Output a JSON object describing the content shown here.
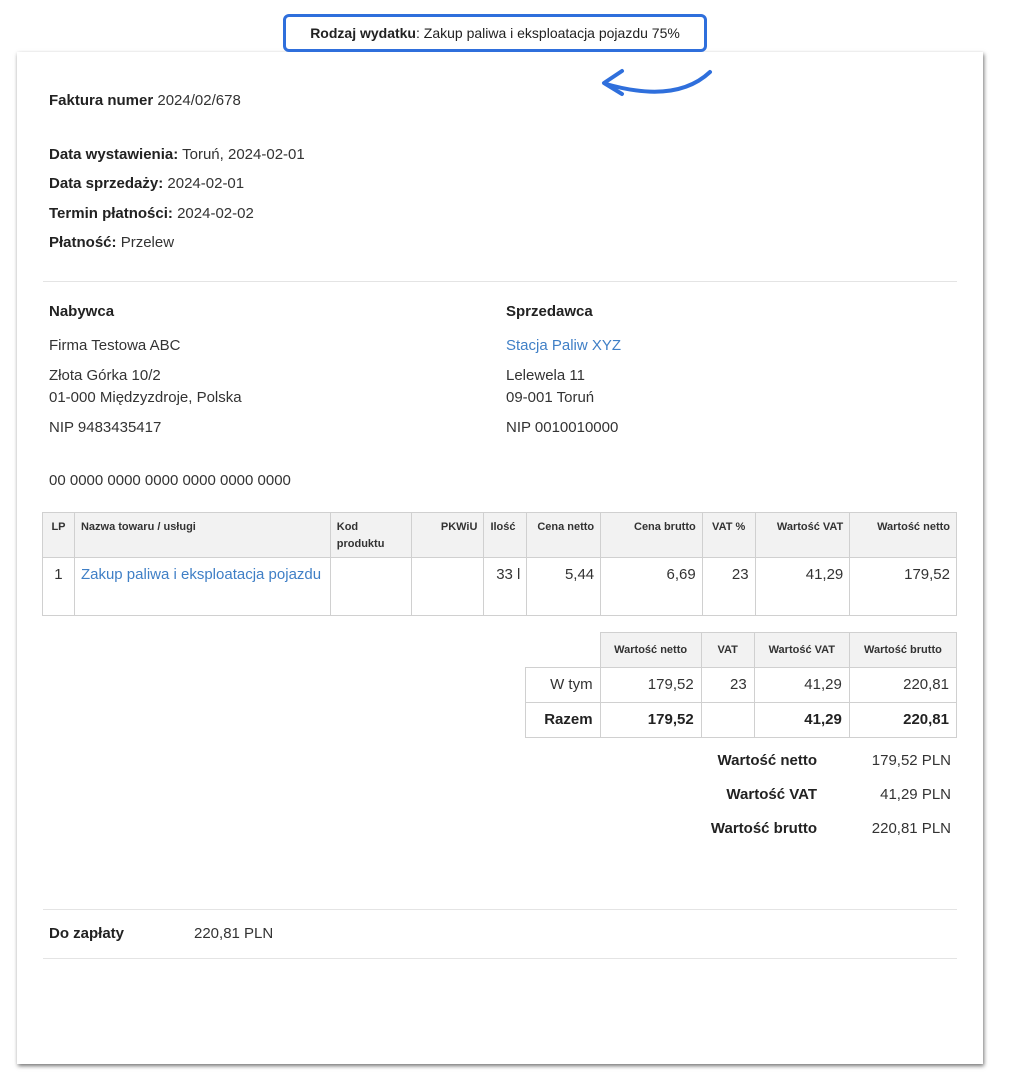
{
  "annotation": {
    "label": "Rodzaj wydatku",
    "value": "Zakup paliwa i eksploatacja pojazdu 75%"
  },
  "invoice": {
    "title_label": "Faktura numer",
    "number": "2024/02/678",
    "details": [
      {
        "label": "Data wystawienia:",
        "value": "Toruń, 2024-02-01"
      },
      {
        "label": "Data sprzedaży:",
        "value": "2024-02-01"
      },
      {
        "label": "Termin płatności:",
        "value": "2024-02-02"
      },
      {
        "label": "Płatność:",
        "value": "Przelew"
      }
    ]
  },
  "buyer": {
    "heading": "Nabywca",
    "name": "Firma Testowa ABC",
    "street": "Złota Górka 10/2",
    "city": "01-000 Międzyzdroje, Polska",
    "nip": "NIP 9483435417"
  },
  "seller": {
    "heading": "Sprzedawca",
    "name": "Stacja Paliw XYZ",
    "street": "Lelewela 11",
    "city": "09-001 Toruń",
    "nip": "NIP 0010010000"
  },
  "bank_account": "00 0000 0000 0000 0000 0000 0000",
  "items_table": {
    "headers": [
      "LP",
      "Nazwa towaru / usługi",
      "Kod produktu",
      "PKWiU",
      "Ilość",
      "Cena netto",
      "Cena brutto",
      "VAT %",
      "Wartość VAT",
      "Wartość netto"
    ],
    "rows": [
      {
        "lp": "1",
        "name": "Zakup paliwa i eksploatacja pojazdu",
        "code": "",
        "pkwiu": "",
        "qty": "33 l",
        "net_price": "5,44",
        "gross_price": "6,69",
        "vat_rate": "23",
        "vat_value": "41,29",
        "net_value": "179,52"
      }
    ]
  },
  "summary_table": {
    "headers": [
      "Wartość netto",
      "VAT",
      "Wartość VAT",
      "Wartość brutto"
    ],
    "rows": [
      {
        "label": "W tym",
        "net": "179,52",
        "vat": "23",
        "vat_value": "41,29",
        "gross": "220,81"
      },
      {
        "label": "Razem",
        "net": "179,52",
        "vat": "",
        "vat_value": "41,29",
        "gross": "220,81"
      }
    ]
  },
  "totals": [
    {
      "label": "Wartość netto",
      "value": "179,52 PLN"
    },
    {
      "label": "Wartość VAT",
      "value": "41,29 PLN"
    },
    {
      "label": "Wartość brutto",
      "value": "220,81 PLN"
    }
  ],
  "to_pay": {
    "label": "Do zapłaty",
    "value": "220,81 PLN"
  },
  "colors": {
    "highlight_border": "#2f6fdc",
    "link": "#3f7fc6"
  }
}
